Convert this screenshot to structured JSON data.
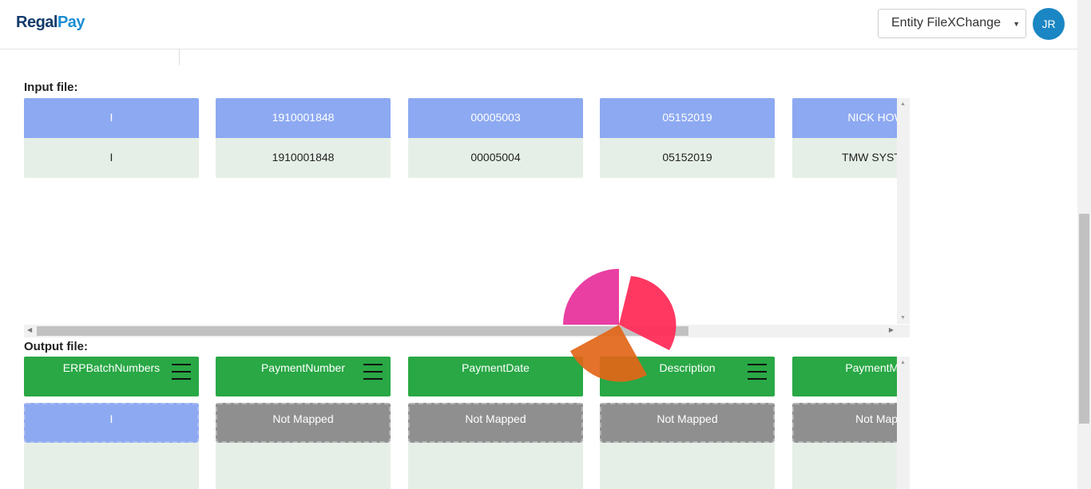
{
  "header": {
    "logo_part1": "Regal",
    "logo_part2": "Pay",
    "entity_select": {
      "value": "Entity FileXChange"
    },
    "avatar_initials": "JR"
  },
  "input_section": {
    "label": "Input file:",
    "columns": [
      {
        "header": "I",
        "value": "I"
      },
      {
        "header": "1910001848",
        "value": "1910001848"
      },
      {
        "header": "00005003",
        "value": "00005004"
      },
      {
        "header": "05152019",
        "value": "05152019"
      },
      {
        "header": "NICK HOWA",
        "value": "TMW SYSTEM"
      }
    ]
  },
  "output_section": {
    "label": "Output file:",
    "columns": [
      {
        "header": "ERPBatchNumbers",
        "mapping": "I",
        "mapped": true,
        "has_menu": true
      },
      {
        "header": "PaymentNumber",
        "mapping": "Not Mapped",
        "mapped": false,
        "has_menu": true
      },
      {
        "header": "PaymentDate",
        "mapping": "Not Mapped",
        "mapped": false,
        "has_menu": false
      },
      {
        "header": "Description",
        "mapping": "Not Mapped",
        "mapped": false,
        "has_menu": true
      },
      {
        "header": "PaymentMeth",
        "mapping": "Not Mapp",
        "mapped": false,
        "has_menu": false
      }
    ]
  },
  "colors": {
    "input_header": "#8da9f1",
    "input_row": "#e6efe7",
    "output_header": "#29a845",
    "not_mapped": "#8f8f8f",
    "brand_dark": "#123a6b",
    "brand_light": "#1b8ed4",
    "spinner_pink": "#e8359e",
    "spinner_red": "#ff2d5a",
    "spinner_orange": "#e26618"
  },
  "icons": {
    "column_menu": "hamburger-menu-icon",
    "select_caret": "caret-down-icon",
    "loader": "loading-spinner-icon"
  }
}
